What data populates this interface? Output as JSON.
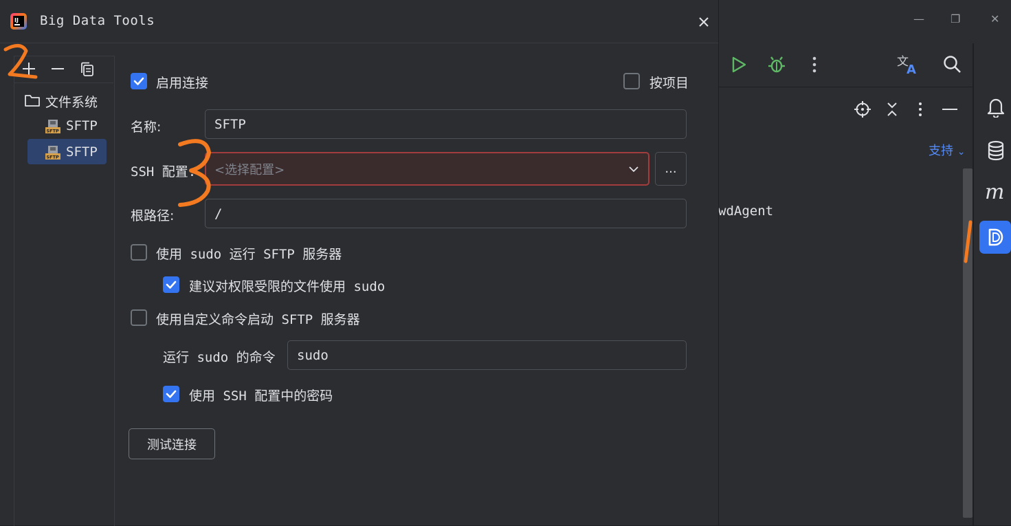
{
  "dialog": {
    "title": "Big Data Tools",
    "tree": {
      "root_label": "文件系统",
      "items": [
        {
          "label": "SFTP",
          "badge": "SFTP",
          "selected": false
        },
        {
          "label": "SFTP",
          "badge": "SFTP",
          "selected": true
        }
      ]
    },
    "form": {
      "enable_connection": {
        "label": "启用连接",
        "checked": true
      },
      "per_project": {
        "label": "按项目",
        "checked": false
      },
      "name": {
        "label": "名称:",
        "value": "SFTP"
      },
      "ssh_config": {
        "label": "SSH 配置:",
        "placeholder": "<选择配置>",
        "browse_label": "..."
      },
      "root_path": {
        "label": "根路径:",
        "value": "/"
      },
      "use_sudo": {
        "label": "使用 sudo 运行 SFTP 服务器",
        "checked": false
      },
      "suggest_sudo": {
        "label": "建议对权限受限的文件使用 sudo",
        "checked": true
      },
      "custom_command": {
        "label": "使用自定义命令启动 SFTP 服务器",
        "checked": false
      },
      "sudo_command": {
        "label": "运行 sudo 的命令",
        "value": "sudo"
      },
      "use_ssh_password": {
        "label": "使用 SSH 配置中的密码",
        "checked": true
      },
      "test_button": "测试连接"
    }
  },
  "ide": {
    "support_link": "支持",
    "log_text": "wdAgent"
  },
  "annotations": [
    "1",
    "2",
    "3"
  ],
  "colors": {
    "accent": "#3574f0",
    "annotation": "#f37a20",
    "error_border": "#a33d3d",
    "link": "#548af7"
  }
}
